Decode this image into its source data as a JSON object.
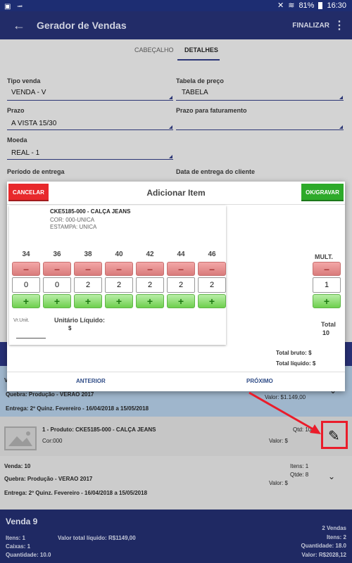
{
  "status_bar": {
    "left_icons": "▣ ⭲",
    "battery": "81%",
    "time": "16:30"
  },
  "app_bar": {
    "title": "Gerador de Vendas",
    "finalizar": "FINALIZAR"
  },
  "tabs": [
    {
      "label": "CABEÇALHO"
    },
    {
      "label": "DETALHES"
    }
  ],
  "form": {
    "tipo_venda": {
      "label": "Tipo venda",
      "value": "VENDA - V"
    },
    "tabela_preco": {
      "label": "Tabela de preço",
      "value": "TABELA"
    },
    "prazo": {
      "label": "Prazo",
      "value": "A VISTA 15/30"
    },
    "prazo_faturamento": {
      "label": "Prazo para faturamento",
      "value": ""
    },
    "moeda": {
      "label": "Moeda",
      "value": "REAL - 1"
    },
    "periodo_entrega": {
      "label": "Período de entrega"
    },
    "data_entrega_cliente": {
      "label": "Data de entrega do cliente"
    }
  },
  "dialog": {
    "title": "Adicionar Item",
    "cancel": "CANCELAR",
    "ok": "OK/GRAVAR",
    "product": {
      "name": "CKE5185-000 - CALÇA JEANS",
      "cor": "COR: 000-UNICA",
      "estampa": "ESTAMPA: UNICA"
    },
    "sizes": [
      {
        "label": "34",
        "qty": "0"
      },
      {
        "label": "36",
        "qty": "0"
      },
      {
        "label": "38",
        "qty": "2"
      },
      {
        "label": "40",
        "qty": "2"
      },
      {
        "label": "42",
        "qty": "2"
      },
      {
        "label": "44",
        "qty": "2"
      },
      {
        "label": "46",
        "qty": "2"
      }
    ],
    "stepper_minus": "–",
    "stepper_plus": "+",
    "mult": {
      "label": "MULT.",
      "value": "1"
    },
    "vr_unit": "Vr.Unit.",
    "unitario_liquido": "Unitário Líquido:",
    "unitario_liquido_value": "$",
    "total_label": "Total",
    "total_value": "10",
    "total_bruto": "Total bruto: $",
    "total_liquido": "Total líquido: $",
    "anterior": "ANTERIOR",
    "proximo": "PRÓXIMO"
  },
  "list": {
    "row1": {
      "quebra": "Quebra: Produção - VERAO 2017",
      "entrega": "Entrega: 2º Quinz. Fevereiro - 16/04/2018 a 15/05/2018",
      "valor": "Valor: $1.149,00",
      "venda_prefix": "V"
    },
    "row2": {
      "produto": "1 -   Produto: CKE5185-000 - CALÇA JEANS",
      "cor": "Cor:000",
      "qtd": "Qtd: 10",
      "valor": "Valor: $"
    },
    "row3": {
      "venda": "Venda: 10",
      "quebra": "Quebra: Produção - VERAO 2017",
      "entrega": "Entrega: 2º Quinz. Fevereiro - 16/04/2018 a 15/05/2018",
      "itens": "Itens: 1",
      "qtde": "Qtde: 8",
      "valor": "Valor: $"
    }
  },
  "footer": {
    "title": "Venda 9",
    "itens": "Itens: 1",
    "caixas": "Caixas: 1",
    "quantidade": "Quantidade: 10.0",
    "valor_total_liquido": "Valor total líquido: R$1149,00",
    "vendas": "2 Vendas",
    "itens_total": "Itens: 2",
    "quantidade_total": "Quantidade: 18.0",
    "valor_total": "Valor: R$2028,12"
  },
  "colors": {
    "app_bar": "#222c68",
    "cancel": "#e8292c",
    "ok": "#2eaa2a",
    "callout": "#ea1c2a",
    "footer": "#1f2963"
  }
}
